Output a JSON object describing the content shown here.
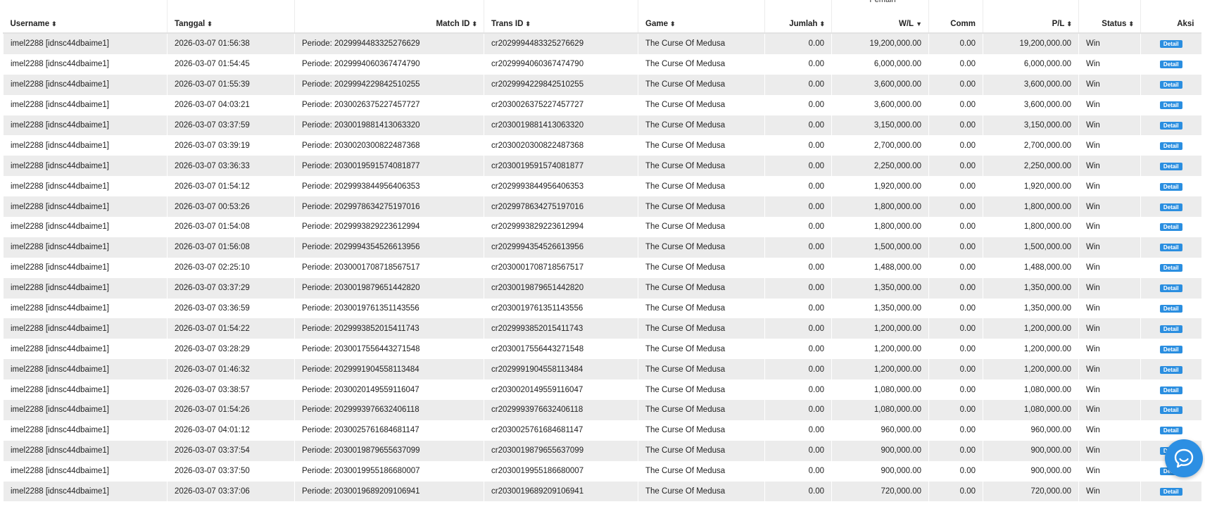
{
  "table": {
    "group_label": "Pemain",
    "columns": [
      {
        "label": "Username",
        "sort": "⬍"
      },
      {
        "label": "Tanggal",
        "sort": "⬍"
      },
      {
        "label": "Match ID",
        "sort": "⬍"
      },
      {
        "label": "Trans ID",
        "sort": "⬍"
      },
      {
        "label": "Game",
        "sort": "⬍"
      },
      {
        "label": "Jumlah",
        "sort": "⬍"
      },
      {
        "label": "W/L",
        "sort": "▼"
      },
      {
        "label": "Comm",
        "sort": ""
      },
      {
        "label": "P/L",
        "sort": "⬍"
      },
      {
        "label": "Status",
        "sort": "⬍"
      },
      {
        "label": "Aksi",
        "sort": ""
      }
    ],
    "detail_label": "Detail",
    "rows": [
      {
        "username": "imel2288 [idnsc44dbaime1]",
        "tanggal": "2026-03-07 01:56:38",
        "match": "Periode: 2029994483325276629",
        "trans": "cr2029994483325276629",
        "game": "The Curse Of Medusa",
        "jumlah": "0.00",
        "wl": "19,200,000.00",
        "comm": "0.00",
        "pl": "19,200,000.00",
        "status": "Win"
      },
      {
        "username": "imel2288 [idnsc44dbaime1]",
        "tanggal": "2026-03-07 01:54:45",
        "match": "Periode: 2029994060367474790",
        "trans": "cr2029994060367474790",
        "game": "The Curse Of Medusa",
        "jumlah": "0.00",
        "wl": "6,000,000.00",
        "comm": "0.00",
        "pl": "6,000,000.00",
        "status": "Win"
      },
      {
        "username": "imel2288 [idnsc44dbaime1]",
        "tanggal": "2026-03-07 01:55:39",
        "match": "Periode: 2029994229842510255",
        "trans": "cr2029994229842510255",
        "game": "The Curse Of Medusa",
        "jumlah": "0.00",
        "wl": "3,600,000.00",
        "comm": "0.00",
        "pl": "3,600,000.00",
        "status": "Win"
      },
      {
        "username": "imel2288 [idnsc44dbaime1]",
        "tanggal": "2026-03-07 04:03:21",
        "match": "Periode: 2030026375227457727",
        "trans": "cr2030026375227457727",
        "game": "The Curse Of Medusa",
        "jumlah": "0.00",
        "wl": "3,600,000.00",
        "comm": "0.00",
        "pl": "3,600,000.00",
        "status": "Win"
      },
      {
        "username": "imel2288 [idnsc44dbaime1]",
        "tanggal": "2026-03-07 03:37:59",
        "match": "Periode: 2030019881413063320",
        "trans": "cr2030019881413063320",
        "game": "The Curse Of Medusa",
        "jumlah": "0.00",
        "wl": "3,150,000.00",
        "comm": "0.00",
        "pl": "3,150,000.00",
        "status": "Win"
      },
      {
        "username": "imel2288 [idnsc44dbaime1]",
        "tanggal": "2026-03-07 03:39:19",
        "match": "Periode: 2030020300822487368",
        "trans": "cr2030020300822487368",
        "game": "The Curse Of Medusa",
        "jumlah": "0.00",
        "wl": "2,700,000.00",
        "comm": "0.00",
        "pl": "2,700,000.00",
        "status": "Win"
      },
      {
        "username": "imel2288 [idnsc44dbaime1]",
        "tanggal": "2026-03-07 03:36:33",
        "match": "Periode: 2030019591574081877",
        "trans": "cr2030019591574081877",
        "game": "The Curse Of Medusa",
        "jumlah": "0.00",
        "wl": "2,250,000.00",
        "comm": "0.00",
        "pl": "2,250,000.00",
        "status": "Win"
      },
      {
        "username": "imel2288 [idnsc44dbaime1]",
        "tanggal": "2026-03-07 01:54:12",
        "match": "Periode: 2029993844956406353",
        "trans": "cr2029993844956406353",
        "game": "The Curse Of Medusa",
        "jumlah": "0.00",
        "wl": "1,920,000.00",
        "comm": "0.00",
        "pl": "1,920,000.00",
        "status": "Win"
      },
      {
        "username": "imel2288 [idnsc44dbaime1]",
        "tanggal": "2026-03-07 00:53:26",
        "match": "Periode: 2029978634275197016",
        "trans": "cr2029978634275197016",
        "game": "The Curse Of Medusa",
        "jumlah": "0.00",
        "wl": "1,800,000.00",
        "comm": "0.00",
        "pl": "1,800,000.00",
        "status": "Win"
      },
      {
        "username": "imel2288 [idnsc44dbaime1]",
        "tanggal": "2026-03-07 01:54:08",
        "match": "Periode: 2029993829223612994",
        "trans": "cr2029993829223612994",
        "game": "The Curse Of Medusa",
        "jumlah": "0.00",
        "wl": "1,800,000.00",
        "comm": "0.00",
        "pl": "1,800,000.00",
        "status": "Win"
      },
      {
        "username": "imel2288 [idnsc44dbaime1]",
        "tanggal": "2026-03-07 01:56:08",
        "match": "Periode: 2029994354526613956",
        "trans": "cr2029994354526613956",
        "game": "The Curse Of Medusa",
        "jumlah": "0.00",
        "wl": "1,500,000.00",
        "comm": "0.00",
        "pl": "1,500,000.00",
        "status": "Win"
      },
      {
        "username": "imel2288 [idnsc44dbaime1]",
        "tanggal": "2026-03-07 02:25:10",
        "match": "Periode: 2030001708718567517",
        "trans": "cr2030001708718567517",
        "game": "The Curse Of Medusa",
        "jumlah": "0.00",
        "wl": "1,488,000.00",
        "comm": "0.00",
        "pl": "1,488,000.00",
        "status": "Win"
      },
      {
        "username": "imel2288 [idnsc44dbaime1]",
        "tanggal": "2026-03-07 03:37:29",
        "match": "Periode: 2030019879651442820",
        "trans": "cr2030019879651442820",
        "game": "The Curse Of Medusa",
        "jumlah": "0.00",
        "wl": "1,350,000.00",
        "comm": "0.00",
        "pl": "1,350,000.00",
        "status": "Win"
      },
      {
        "username": "imel2288 [idnsc44dbaime1]",
        "tanggal": "2026-03-07 03:36:59",
        "match": "Periode: 2030019761351143556",
        "trans": "cr2030019761351143556",
        "game": "The Curse Of Medusa",
        "jumlah": "0.00",
        "wl": "1,350,000.00",
        "comm": "0.00",
        "pl": "1,350,000.00",
        "status": "Win"
      },
      {
        "username": "imel2288 [idnsc44dbaime1]",
        "tanggal": "2026-03-07 01:54:22",
        "match": "Periode: 2029993852015411743",
        "trans": "cr2029993852015411743",
        "game": "The Curse Of Medusa",
        "jumlah": "0.00",
        "wl": "1,200,000.00",
        "comm": "0.00",
        "pl": "1,200,000.00",
        "status": "Win"
      },
      {
        "username": "imel2288 [idnsc44dbaime1]",
        "tanggal": "2026-03-07 03:28:29",
        "match": "Periode: 2030017556443271548",
        "trans": "cr2030017556443271548",
        "game": "The Curse Of Medusa",
        "jumlah": "0.00",
        "wl": "1,200,000.00",
        "comm": "0.00",
        "pl": "1,200,000.00",
        "status": "Win"
      },
      {
        "username": "imel2288 [idnsc44dbaime1]",
        "tanggal": "2026-03-07 01:46:32",
        "match": "Periode: 2029991904558113484",
        "trans": "cr2029991904558113484",
        "game": "The Curse Of Medusa",
        "jumlah": "0.00",
        "wl": "1,200,000.00",
        "comm": "0.00",
        "pl": "1,200,000.00",
        "status": "Win"
      },
      {
        "username": "imel2288 [idnsc44dbaime1]",
        "tanggal": "2026-03-07 03:38:57",
        "match": "Periode: 2030020149559116047",
        "trans": "cr2030020149559116047",
        "game": "The Curse Of Medusa",
        "jumlah": "0.00",
        "wl": "1,080,000.00",
        "comm": "0.00",
        "pl": "1,080,000.00",
        "status": "Win"
      },
      {
        "username": "imel2288 [idnsc44dbaime1]",
        "tanggal": "2026-03-07 01:54:26",
        "match": "Periode: 2029993976632406118",
        "trans": "cr2029993976632406118",
        "game": "The Curse Of Medusa",
        "jumlah": "0.00",
        "wl": "1,080,000.00",
        "comm": "0.00",
        "pl": "1,080,000.00",
        "status": "Win"
      },
      {
        "username": "imel2288 [idnsc44dbaime1]",
        "tanggal": "2026-03-07 04:01:12",
        "match": "Periode: 2030025761684681147",
        "trans": "cr2030025761684681147",
        "game": "The Curse Of Medusa",
        "jumlah": "0.00",
        "wl": "960,000.00",
        "comm": "0.00",
        "pl": "960,000.00",
        "status": "Win"
      },
      {
        "username": "imel2288 [idnsc44dbaime1]",
        "tanggal": "2026-03-07 03:37:54",
        "match": "Periode: 2030019879655637099",
        "trans": "cr2030019879655637099",
        "game": "The Curse Of Medusa",
        "jumlah": "0.00",
        "wl": "900,000.00",
        "comm": "0.00",
        "pl": "900,000.00",
        "status": "Win"
      },
      {
        "username": "imel2288 [idnsc44dbaime1]",
        "tanggal": "2026-03-07 03:37:50",
        "match": "Periode: 2030019955186680007",
        "trans": "cr2030019955186680007",
        "game": "The Curse Of Medusa",
        "jumlah": "0.00",
        "wl": "900,000.00",
        "comm": "0.00",
        "pl": "900,000.00",
        "status": "Win"
      },
      {
        "username": "imel2288 [idnsc44dbaime1]",
        "tanggal": "2026-03-07 03:37:06",
        "match": "Periode: 2030019689209106941",
        "trans": "cr2030019689209106941",
        "game": "The Curse Of Medusa",
        "jumlah": "0.00",
        "wl": "720,000.00",
        "comm": "0.00",
        "pl": "720,000.00",
        "status": "Win"
      }
    ]
  },
  "chat_widget": {
    "icon": "chat-bubble-icon"
  }
}
